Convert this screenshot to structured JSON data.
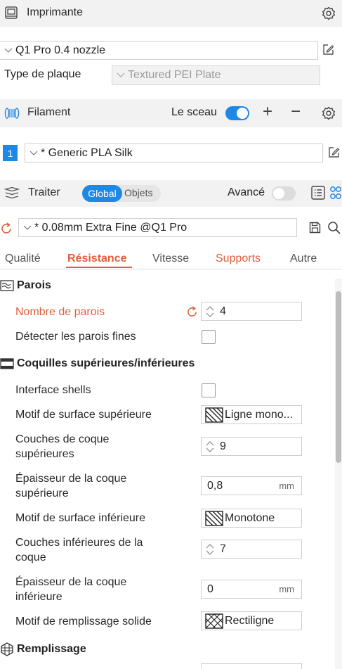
{
  "printer": {
    "title": "Imprimante",
    "preset": "Q1 Pro 0.4 nozzle",
    "plate_label": "Type de plaque",
    "plate_value": "Textured PEI Plate"
  },
  "filament": {
    "title": "Filament",
    "seal_label": "Le sceau",
    "seal_on": true,
    "plus": "+",
    "minus": "−",
    "slot_number": "1",
    "slot_color": "#1e88e5",
    "preset": "* Generic PLA Silk"
  },
  "process": {
    "title": "Traiter",
    "mode_global": "Global",
    "mode_objects": "Objets",
    "advanced_label": "Avancé",
    "advanced_on": false,
    "preset": "* 0.08mm Extra Fine @Q1 Pro"
  },
  "tabs": {
    "quality": "Qualité",
    "strength": "Résistance",
    "speed": "Vitesse",
    "supports": "Supports",
    "other": "Autre"
  },
  "walls": {
    "title": "Parois",
    "wall_count_label": "Nombre de parois",
    "wall_count_value": "4",
    "detect_thin_label": "Détecter les parois fines",
    "detect_thin_checked": false
  },
  "shells": {
    "title": "Coquilles supérieures/inférieures",
    "interface_label": "Interface shells",
    "interface_checked": false,
    "top_pattern_label": "Motif de surface supérieure",
    "top_pattern_value": "Ligne mono...",
    "top_layers_label_1": "Couches de coque",
    "top_layers_label_2": "supérieures",
    "top_layers_value": "9",
    "top_thickness_label_1": "Épaisseur de la coque",
    "top_thickness_label_2": "supérieure",
    "top_thickness_value": "0,8",
    "unit_mm": "mm",
    "bottom_pattern_label": "Motif de surface inférieure",
    "bottom_pattern_value": "Monotone",
    "bottom_layers_label_1": "Couches inférieures de la",
    "bottom_layers_label_2": "coque",
    "bottom_layers_value": "7",
    "bottom_thickness_label_1": "Épaisseur de la coque",
    "bottom_thickness_label_2": "inférieure",
    "bottom_thickness_value": "0",
    "solid_infill_label": "Motif de remplissage solide",
    "solid_infill_value": "Rectiligne"
  },
  "infill": {
    "title": "Remplissage"
  },
  "colors": {
    "accent_blue": "#1e88e5",
    "accent_orange": "#e0603c",
    "section_bg": "#f2f2f2"
  },
  "icons": [
    "gear-icon",
    "edit-icon",
    "filament-icon",
    "process-icon",
    "reset-icon",
    "save-icon",
    "search-icon",
    "list-icon",
    "split-icon",
    "walls-icon",
    "shells-icon",
    "infill-icon"
  ]
}
